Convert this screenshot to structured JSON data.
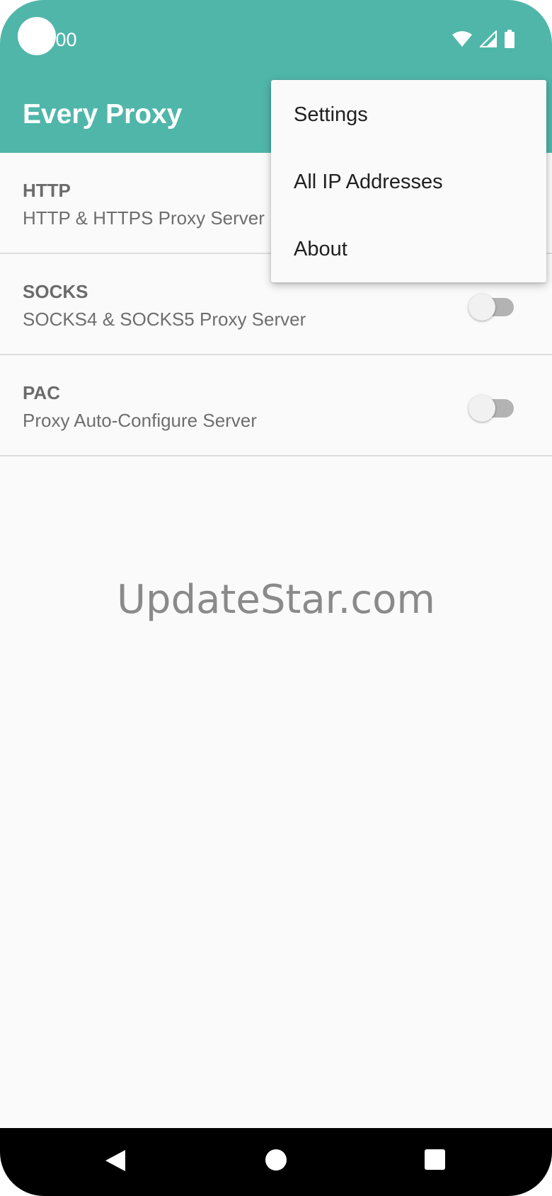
{
  "status_bar": {
    "time": "0:00",
    "icons": [
      "wifi-icon",
      "signal-icon",
      "battery-icon"
    ]
  },
  "app_bar": {
    "title": "Every Proxy"
  },
  "servers": [
    {
      "title": "HTTP",
      "subtitle": "HTTP & HTTPS Proxy Server",
      "enabled": false
    },
    {
      "title": "SOCKS",
      "subtitle": "SOCKS4 & SOCKS5 Proxy Server",
      "enabled": false
    },
    {
      "title": "PAC",
      "subtitle": "Proxy Auto-Configure Server",
      "enabled": false
    }
  ],
  "overflow_menu": {
    "items": [
      "Settings",
      "All IP Addresses",
      "About"
    ]
  },
  "watermark": "UpdateStar.com",
  "nav_bar": {
    "icons": [
      "back-icon",
      "home-icon",
      "recents-icon"
    ]
  },
  "colors": {
    "primary": "#50b6aa",
    "background": "#fafafa",
    "switch_track_off": "#b3b3b3"
  }
}
